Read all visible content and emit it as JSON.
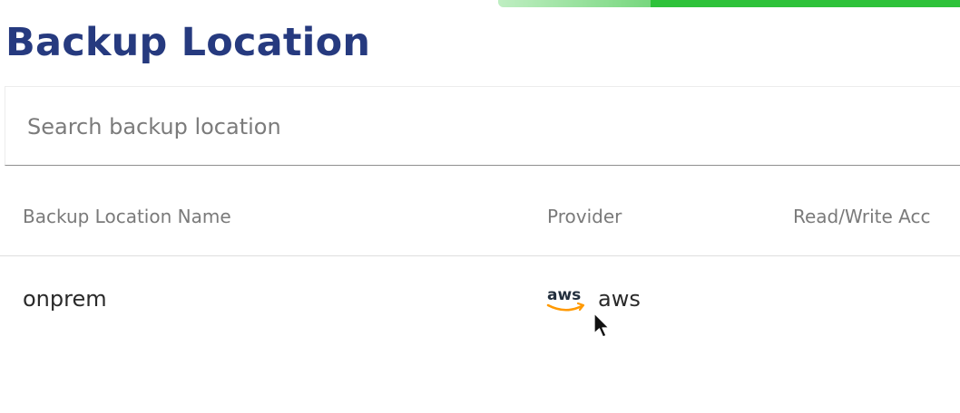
{
  "progress": {
    "fraction": 0.67
  },
  "page": {
    "title": "Backup Location"
  },
  "search": {
    "placeholder": "Search backup location",
    "value": ""
  },
  "table": {
    "columns": [
      "Backup Location Name",
      "Provider",
      "Read/Write Acc"
    ],
    "rows": [
      {
        "name": "onprem",
        "provider": "aws",
        "provider_logo_text": "aws"
      }
    ]
  },
  "colors": {
    "title": "#263a7f",
    "progress": "#2ec23a",
    "aws_smile": "#ff9900"
  },
  "icons": {
    "provider_logo": "aws-logo-icon",
    "cursor": "mouse-pointer-icon"
  }
}
